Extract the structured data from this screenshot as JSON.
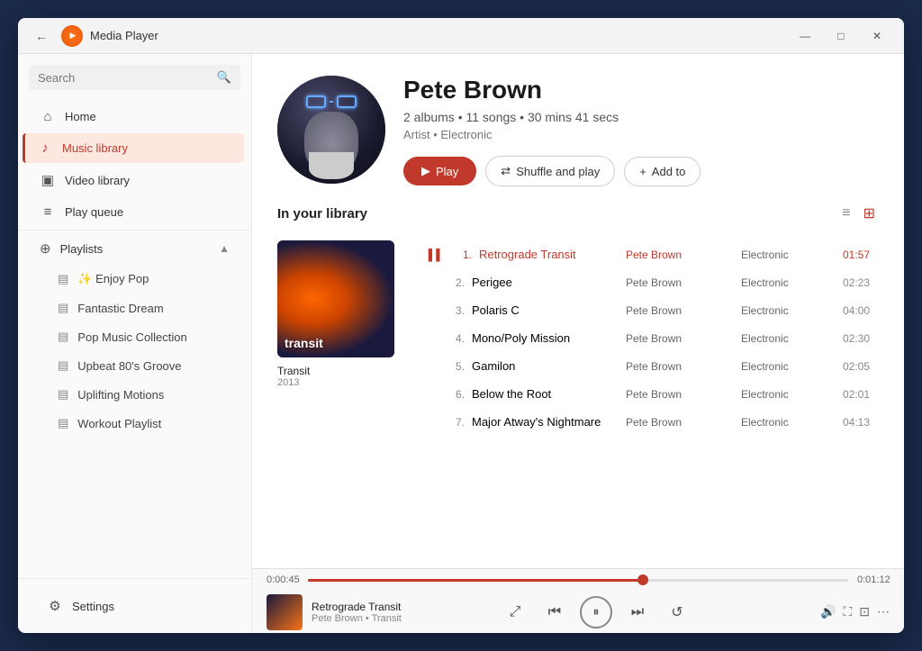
{
  "titlebar": {
    "title": "Media Player",
    "back_label": "←",
    "minimize": "—",
    "maximize": "□",
    "close": "✕"
  },
  "sidebar": {
    "search_placeholder": "Search",
    "nav": [
      {
        "id": "home",
        "label": "Home",
        "icon": "⌂"
      },
      {
        "id": "music-library",
        "label": "Music library",
        "icon": "♪",
        "active": true
      },
      {
        "id": "video-library",
        "label": "Video library",
        "icon": "▣"
      },
      {
        "id": "play-queue",
        "label": "Play queue",
        "icon": "≡"
      }
    ],
    "playlists_label": "Playlists",
    "playlists": [
      {
        "label": "✨ Enjoy Pop"
      },
      {
        "label": "Fantastic Dream"
      },
      {
        "label": "Pop Music Collection"
      },
      {
        "label": "Upbeat 80's Groove"
      },
      {
        "label": "Uplifting Motions"
      },
      {
        "label": "Workout Playlist"
      }
    ],
    "settings_label": "Settings"
  },
  "artist": {
    "name": "Pete Brown",
    "stats": "2 albums • 11 songs • 30 mins 41 secs",
    "genre": "Artist • Electronic",
    "play_label": "Play",
    "shuffle_label": "Shuffle and play",
    "add_label": "Add to"
  },
  "library": {
    "section_title": "In your library",
    "album": {
      "name": "Transit",
      "year": "2013",
      "thumb_text": "transit"
    },
    "tracks": [
      {
        "num": "1.",
        "name": "Retrograde Transit",
        "artist": "Pete Brown",
        "genre": "Electronic",
        "duration": "01:57",
        "playing": true
      },
      {
        "num": "2.",
        "name": "Perigee",
        "artist": "Pete Brown",
        "genre": "Electronic",
        "duration": "02:23",
        "playing": false
      },
      {
        "num": "3.",
        "name": "Polaris C",
        "artist": "Pete Brown",
        "genre": "Electronic",
        "duration": "04:00",
        "playing": false
      },
      {
        "num": "4.",
        "name": "Mono/Poly Mission",
        "artist": "Pete Brown",
        "genre": "Electronic",
        "duration": "02:30",
        "playing": false
      },
      {
        "num": "5.",
        "name": "Gamilon",
        "artist": "Pete Brown",
        "genre": "Electronic",
        "duration": "02:05",
        "playing": false
      },
      {
        "num": "6.",
        "name": "Below the Root",
        "artist": "Pete Brown",
        "genre": "Electronic",
        "duration": "02:01",
        "playing": false
      },
      {
        "num": "7.",
        "name": "Major Atway's Nightmare",
        "artist": "Pete Brown",
        "genre": "Electronic",
        "duration": "04:13",
        "playing": false
      }
    ]
  },
  "player": {
    "current_time": "0:00:45",
    "total_time": "0:01:12",
    "progress_pct": 62,
    "track_title": "Retrograde Transit",
    "track_sub": "Pete Brown • Transit"
  }
}
